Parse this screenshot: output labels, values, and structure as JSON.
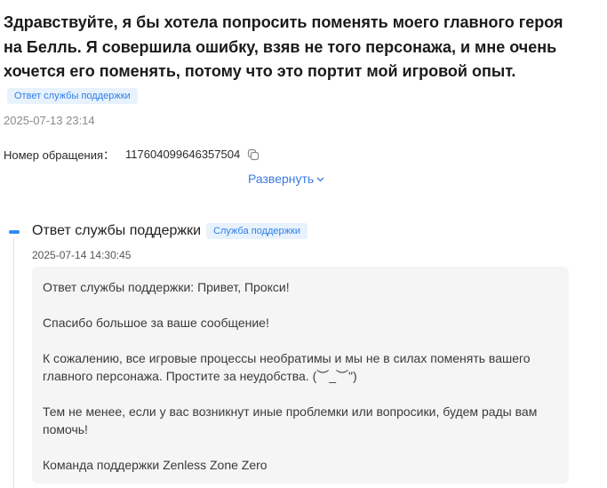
{
  "question": {
    "text": "Здравствуйте, я бы хотела попросить поменять моего главного героя на Белль. Я совершила ошибку, взяв не того персонажа, и мне очень хочется его поменять, потому что это портит мой игровой опыт.",
    "tag": "Ответ службы поддержки",
    "date": "2025-07-13 23:14"
  },
  "ticket": {
    "label": "Номер обращения：",
    "number": "117604099646357504"
  },
  "expand_label": "Развернуть",
  "reply": {
    "title": "Ответ службы поддержки",
    "tag": "Служба поддержки",
    "date": "2025-07-14 14:30:45",
    "paragraphs": [
      "Ответ службы поддержки: Привет, Прокси!",
      "Спасибо большое за ваше сообщение!",
      "К сожалению, все игровые процессы необратимы и мы не в силах поменять вашего главного персонажа. Простите за неудобства.  (︶_︶\")",
      "Тем не менее, если у вас возникнут иные проблемки или вопросики, будем рады вам помочь!",
      "Команда поддержки Zenless Zone Zero"
    ]
  },
  "colors": {
    "accent": "#2f8cf0",
    "tag_bg": "#e8f2fd",
    "tag_text": "#2f7fe8",
    "link": "#3b7ae0",
    "reply_bg": "#f5f5f5"
  },
  "icons": {
    "copy": "copy-icon",
    "expand": "chevron-down-icon"
  }
}
